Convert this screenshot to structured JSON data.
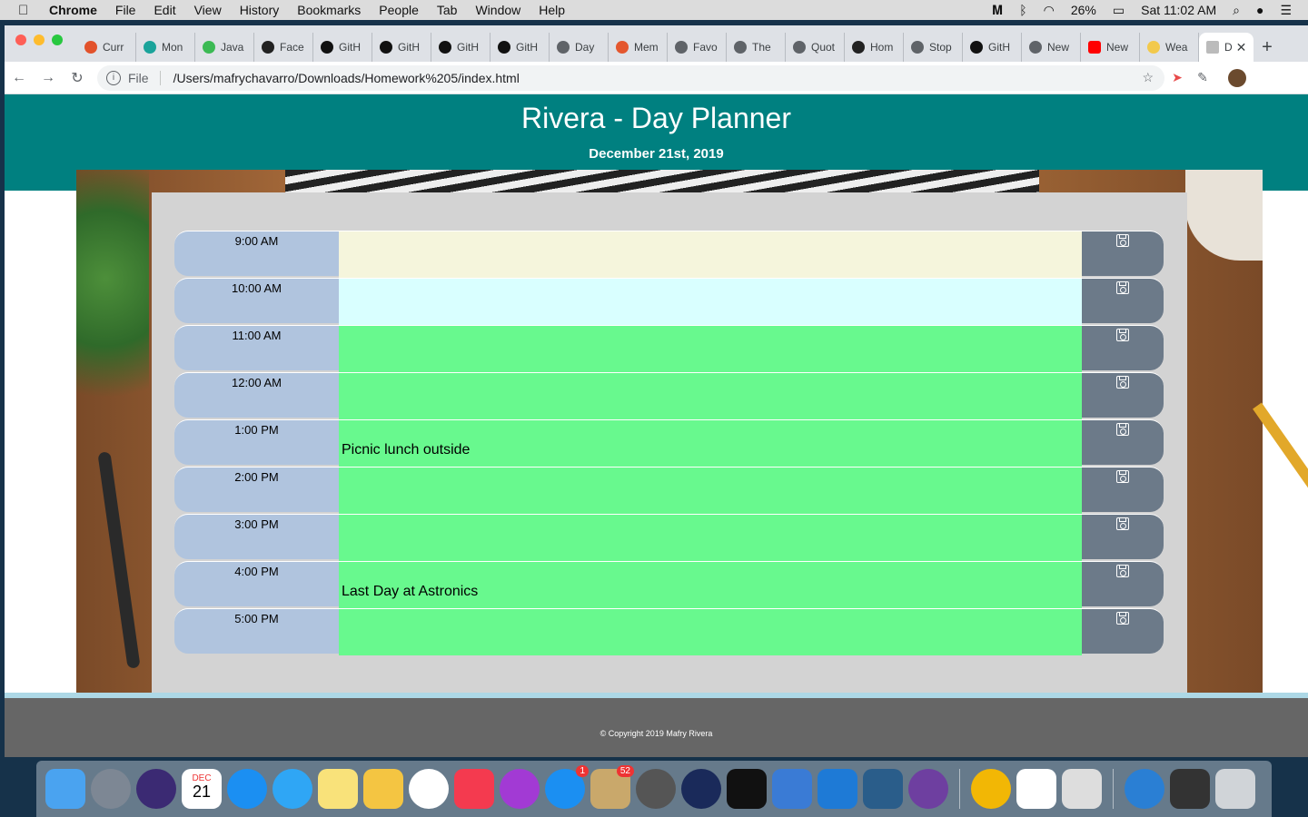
{
  "menubar": {
    "app": "Chrome",
    "menus": [
      "File",
      "Edit",
      "View",
      "History",
      "Bookmarks",
      "People",
      "Tab",
      "Window",
      "Help"
    ],
    "battery": "26%",
    "clock": "Sat 11:02 AM"
  },
  "tabs": [
    {
      "label": "Curr"
    },
    {
      "label": "Mon"
    },
    {
      "label": "Java"
    },
    {
      "label": "Face"
    },
    {
      "label": "GitH"
    },
    {
      "label": "GitH"
    },
    {
      "label": "GitH"
    },
    {
      "label": "GitH"
    },
    {
      "label": "Day"
    },
    {
      "label": "Mem"
    },
    {
      "label": "Favo"
    },
    {
      "label": "The"
    },
    {
      "label": "Quot"
    },
    {
      "label": "Hom"
    },
    {
      "label": "Stop"
    },
    {
      "label": "GitH"
    },
    {
      "label": "New"
    },
    {
      "label": "New"
    },
    {
      "label": "Wea"
    },
    {
      "label": "D"
    }
  ],
  "address": {
    "scheme": "File",
    "url": "/Users/mafrychavarro/Downloads/Homework%205/index.html"
  },
  "header": {
    "title": "Rivera - Day Planner",
    "date": "December 21st, 2019"
  },
  "planner": {
    "rows": [
      {
        "hour": "9:00 AM",
        "text": "",
        "state": "past"
      },
      {
        "hour": "10:00 AM",
        "text": "",
        "state": "present"
      },
      {
        "hour": "11:00 AM",
        "text": "",
        "state": "future"
      },
      {
        "hour": "12:00 AM",
        "text": "",
        "state": "future"
      },
      {
        "hour": "1:00 PM",
        "text": "Picnic lunch outside",
        "state": "future"
      },
      {
        "hour": "2:00 PM",
        "text": "",
        "state": "future"
      },
      {
        "hour": "3:00 PM",
        "text": "",
        "state": "future"
      },
      {
        "hour": "4:00 PM",
        "text": "Last Day at Astronics",
        "state": "future"
      },
      {
        "hour": "5:00 PM",
        "text": "",
        "state": "future"
      }
    ]
  },
  "footer": {
    "copyright": "© Copyright 2019 Mafry Rivera"
  },
  "dock": {
    "badges": {
      "app_store": "1",
      "mail": "52"
    },
    "calendar": {
      "month": "DEC",
      "day": "21"
    }
  },
  "colors": {
    "header_bg": "#008080",
    "past": "#f5f5dc",
    "present": "#d9ffff",
    "future": "#68f98e",
    "hour_bg": "#b0c4de",
    "save_bg": "#6c7a89",
    "footer_bg": "#666666"
  }
}
